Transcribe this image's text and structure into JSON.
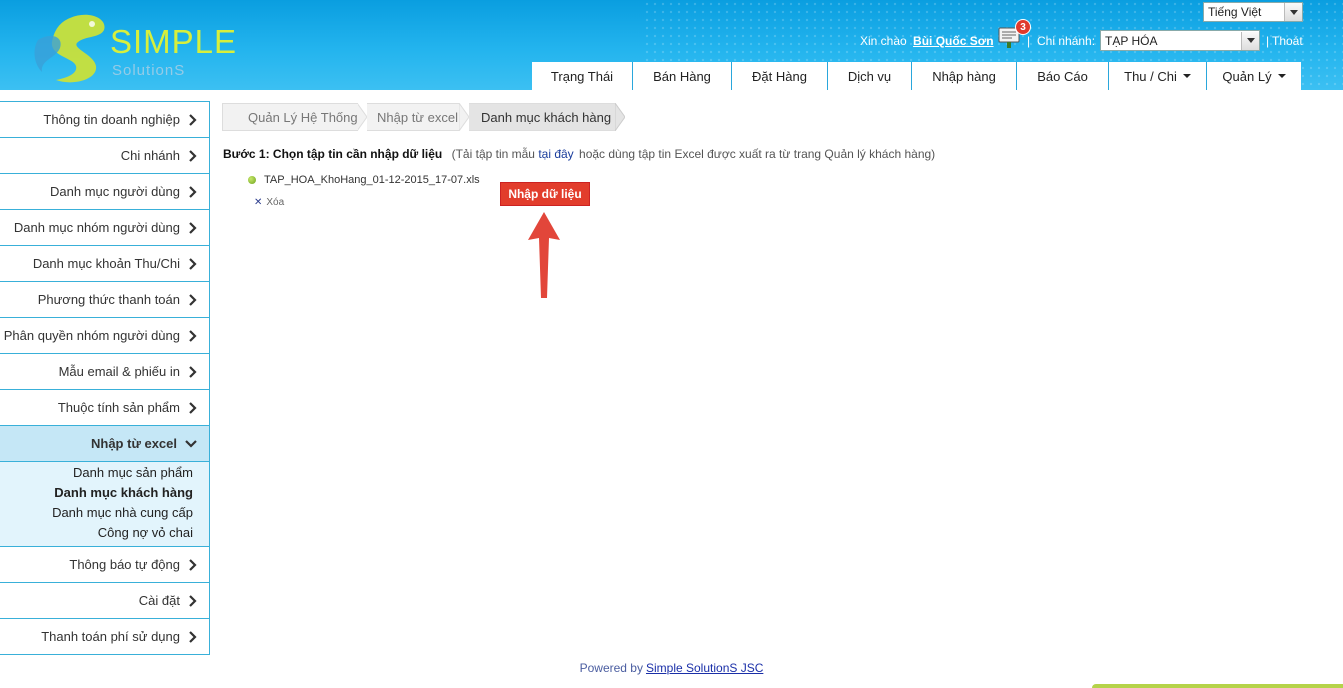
{
  "header": {
    "logo_text": "SIMPLE",
    "logo_sub": "SolutionS",
    "language": "Tiếng Việt",
    "greeting": "Xin chào",
    "user_name": "Bùi Quốc Sơn",
    "notification_count": "3",
    "separator": "|",
    "branch_label": "Chi nhánh:",
    "branch_value": "TẠP HÓA",
    "logout": "Thoát"
  },
  "nav": {
    "tabs": [
      {
        "label": "Trạng Thái"
      },
      {
        "label": "Bán Hàng"
      },
      {
        "label": "Đặt Hàng"
      },
      {
        "label": "Dịch vụ"
      },
      {
        "label": "Nhập hàng"
      },
      {
        "label": "Báo Cáo"
      },
      {
        "label": "Thu / Chi"
      },
      {
        "label": "Quản Lý"
      }
    ]
  },
  "sidebar": {
    "items": [
      {
        "label": "Thông tin doanh nghiệp"
      },
      {
        "label": "Chi nhánh"
      },
      {
        "label": "Danh mục người dùng"
      },
      {
        "label": "Danh mục nhóm người dùng"
      },
      {
        "label": "Danh mục khoản Thu/Chi"
      },
      {
        "label": "Phương thức thanh toán"
      },
      {
        "label": "Phân quyền nhóm người dùng"
      },
      {
        "label": "Mẫu email & phiếu in"
      },
      {
        "label": "Thuộc tính sản phẩm"
      },
      {
        "label": "Nhập từ excel"
      },
      {
        "label": "Thông báo tự động"
      },
      {
        "label": "Cài đặt"
      },
      {
        "label": "Thanh toán phí sử dụng"
      }
    ],
    "subitems": [
      {
        "label": "Danh mục sản phẩm"
      },
      {
        "label": "Danh mục khách hàng"
      },
      {
        "label": "Danh mục nhà cung cấp"
      },
      {
        "label": "Công nợ vỏ chai"
      }
    ]
  },
  "breadcrumb": {
    "items": [
      {
        "label": "Quản Lý Hệ Thống"
      },
      {
        "label": "Nhập từ excel"
      },
      {
        "label": "Danh mục khách hàng"
      }
    ]
  },
  "main": {
    "step_label": "Bước 1: Chọn tập tin cần nhập dữ liệu",
    "hint_before": "(Tải tập tin mẫu",
    "hint_link": "tại đây",
    "hint_after": "hoặc dùng tập tin Excel được xuất ra từ trang Quản lý khách hàng)",
    "file_name": "TAP_HOA_KhoHang_01-12-2015_17-07.xls",
    "delete_label": "Xóa",
    "import_button": "Nhập dữ liệu"
  },
  "footer": {
    "powered_by": "Powered by",
    "company": "Simple SolutionS JSC"
  },
  "colors": {
    "header_blue": "#23b4ee",
    "accent_red": "#e23d2c",
    "logo_green": "#d7ef3c",
    "sidebar_border": "#39b0d9"
  }
}
